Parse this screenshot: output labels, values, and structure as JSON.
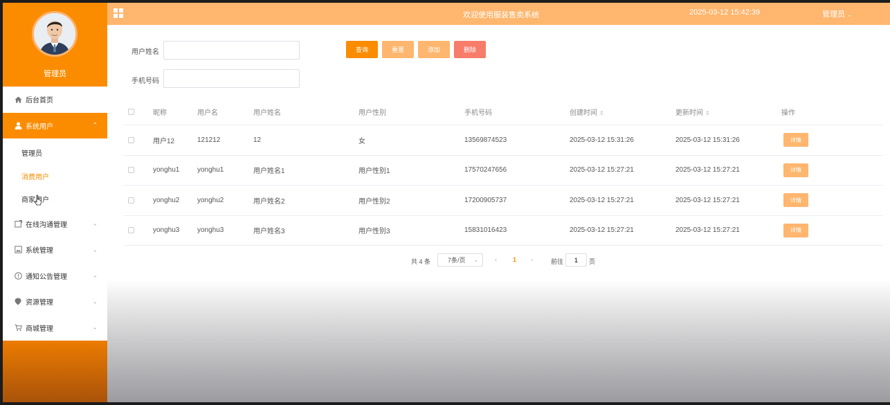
{
  "sidebar": {
    "profile_name": "管理员",
    "menu": [
      {
        "label": "后台首页",
        "icon": "home-icon"
      },
      {
        "label": "系统用户",
        "icon": "user-icon",
        "active": true
      },
      {
        "label": "在线沟通管理",
        "icon": "chat-icon"
      },
      {
        "label": "系统管理",
        "icon": "image-icon"
      },
      {
        "label": "通知公告管理",
        "icon": "info-icon"
      },
      {
        "label": "资源管理",
        "icon": "location-icon"
      },
      {
        "label": "商城管理",
        "icon": "cart-icon"
      }
    ],
    "submenu": [
      {
        "label": "管理员"
      },
      {
        "label": "消费用户"
      },
      {
        "label": "商家用户"
      }
    ]
  },
  "topbar": {
    "title": "欢迎使用服装售卖系统",
    "datetime": "2025-03-12 15:42:39",
    "user": "管理员"
  },
  "filters": {
    "name_label": "用户姓名",
    "name_value": "",
    "phone_label": "手机号码",
    "phone_value": ""
  },
  "buttons": {
    "search": "查询",
    "reset": "重置",
    "add": "添加",
    "delete": "删除"
  },
  "table": {
    "columns": [
      "昵称",
      "用户名",
      "用户姓名",
      "用户性别",
      "手机号码",
      "创建时间",
      "更新时间",
      "操作"
    ],
    "rows": [
      {
        "nickname": "用户12",
        "username": "121212",
        "realname": "12",
        "gender": "女",
        "phone": "13569874523",
        "created": "2025-03-12 15:31:26",
        "updated": "2025-03-12 15:31:26",
        "action": "详情"
      },
      {
        "nickname": "yonghu1",
        "username": "yonghu1",
        "realname": "用户姓名1",
        "gender": "用户性别1",
        "phone": "17570247656",
        "created": "2025-03-12 15:27:21",
        "updated": "2025-03-12 15:27:21",
        "action": "详情"
      },
      {
        "nickname": "yonghu2",
        "username": "yonghu2",
        "realname": "用户姓名2",
        "gender": "用户性别2",
        "phone": "17200905737",
        "created": "2025-03-12 15:27:21",
        "updated": "2025-03-12 15:27:21",
        "action": "详情"
      },
      {
        "nickname": "yonghu3",
        "username": "yonghu3",
        "realname": "用户姓名3",
        "gender": "用户性别3",
        "phone": "15831016423",
        "created": "2025-03-12 15:27:21",
        "updated": "2025-03-12 15:27:21",
        "action": "详情"
      }
    ]
  },
  "pagination": {
    "total": "共 4 条",
    "page_size": "7条/页",
    "current": "1",
    "goto_label": "前往",
    "goto_value": "1",
    "page_suffix": "页"
  },
  "colors": {
    "accent": "#fb8c00",
    "accent_light": "#ffb66e",
    "danger": "#f77c6a"
  }
}
